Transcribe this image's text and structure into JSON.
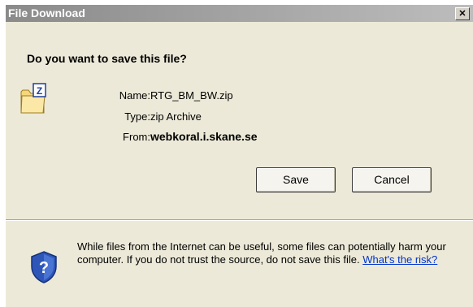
{
  "window": {
    "title": "File Download",
    "close_glyph": "✕"
  },
  "prompt": {
    "question": "Do you want to save this file?"
  },
  "file": {
    "icon": "zip-folder-icon",
    "icon_letter": "Z",
    "name_label": "Name:",
    "name": "RTG_BM_BW.zip",
    "type_label": "Type:",
    "type": "zip Archive",
    "from_label": "From:",
    "from": "webkoral.i.skane.se"
  },
  "buttons": {
    "save": "Save",
    "cancel": "Cancel"
  },
  "warning": {
    "icon": "shield-question-icon",
    "text": "While files from the Internet can be useful, some files can potentially harm your computer. If you do not trust the source, do not save this file.",
    "link": "What's the risk?"
  },
  "colors": {
    "dialog_bg": "#ece9d8",
    "titlebar_start": "#8a8a8a",
    "titlebar_end": "#bdbdbd",
    "link": "#0033cc",
    "folder": "#f5d67a",
    "shield": "#2e56b8"
  }
}
